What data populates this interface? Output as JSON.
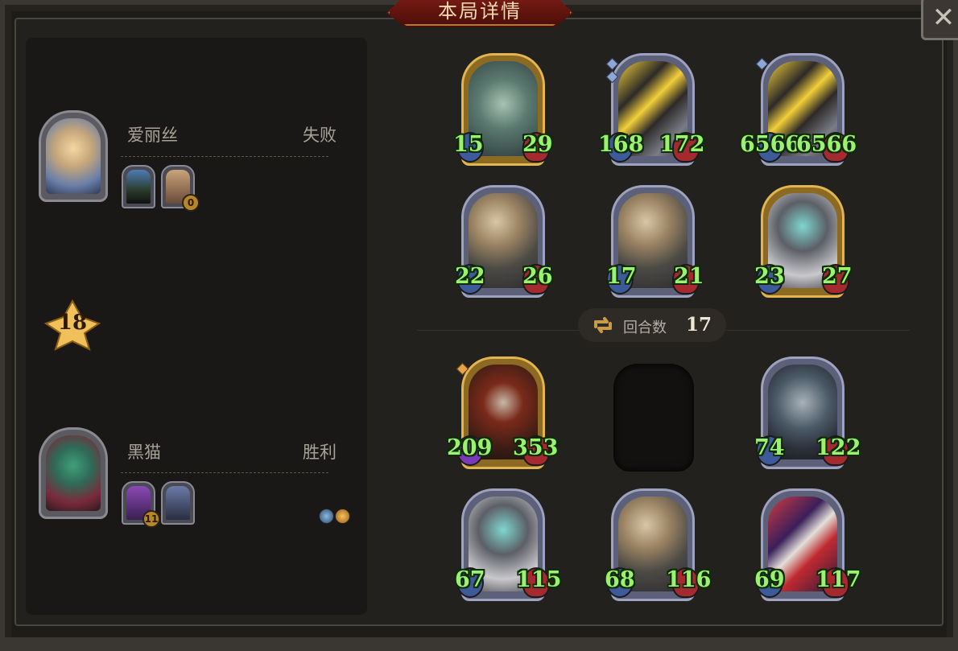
{
  "window": {
    "title": "本局详情",
    "close_label": "✕"
  },
  "players": [
    {
      "name": "爱丽丝",
      "result": "失败",
      "portrait": "alice-portrait",
      "mini_cards": [
        {
          "icon": "dark-tree-card",
          "badge": ""
        },
        {
          "icon": "girl-card",
          "badge": "0"
        }
      ]
    },
    {
      "name": "黑猫",
      "result": "胜利",
      "portrait": "black-cat-portrait",
      "mini_cards": [
        {
          "icon": "purple-mage-card",
          "badge": "11"
        },
        {
          "icon": "armor-card",
          "badge": ""
        }
      ],
      "extra_icons": [
        "sword-ring-icon",
        "coin-icon"
      ]
    }
  ],
  "tier": {
    "value": "18"
  },
  "round": {
    "label": "回合数",
    "value": "17"
  },
  "opponent_board": [
    {
      "name": "fish-knight",
      "attack": "15",
      "health": "29",
      "golden": true
    },
    {
      "name": "cannon-bot",
      "attack": "168",
      "health": "172",
      "golden": false
    },
    {
      "name": "cannon-bot",
      "attack": "6566",
      "health": "6566",
      "golden": false
    },
    {
      "name": "airship",
      "attack": "22",
      "health": "26",
      "golden": false
    },
    {
      "name": "airship",
      "attack": "17",
      "health": "21",
      "golden": false
    },
    {
      "name": "bell-robot",
      "attack": "23",
      "health": "27",
      "golden": true
    }
  ],
  "player_board": [
    {
      "name": "red-hood-assassin",
      "attack": "209",
      "health": "353",
      "golden": true
    },
    {
      "name": "empty-slot",
      "attack": "",
      "health": "",
      "golden": false
    },
    {
      "name": "horned-demoness",
      "attack": "74",
      "health": "122",
      "golden": false
    },
    {
      "name": "bell-robot",
      "attack": "67",
      "health": "115",
      "golden": false
    },
    {
      "name": "airship",
      "attack": "68",
      "health": "116",
      "golden": false
    },
    {
      "name": "clown",
      "attack": "69",
      "health": "117",
      "golden": false
    }
  ]
}
